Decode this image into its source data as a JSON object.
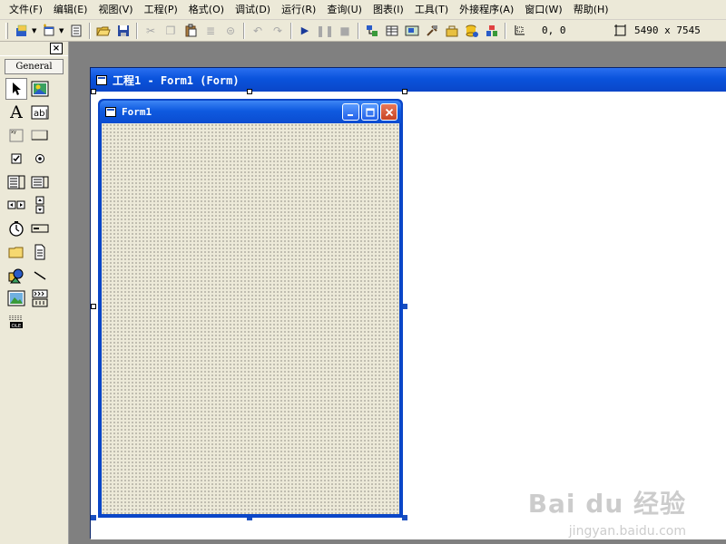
{
  "menu": [
    "文件(F)",
    "编辑(E)",
    "视图(V)",
    "工程(P)",
    "格式(O)",
    "调试(D)",
    "运行(R)",
    "查询(U)",
    "图表(I)",
    "工具(T)",
    "外接程序(A)",
    "窗口(W)",
    "帮助(H)"
  ],
  "toolbar": {
    "position": "0, 0",
    "size": "5490 x 7545"
  },
  "toolbox": {
    "close": "×",
    "tab": "General"
  },
  "designer": {
    "title": "工程1 - Form1 (Form)"
  },
  "form": {
    "title": "Form1"
  },
  "watermark": {
    "text": "Bai du 经验",
    "url": "jingyan.baidu.com"
  }
}
